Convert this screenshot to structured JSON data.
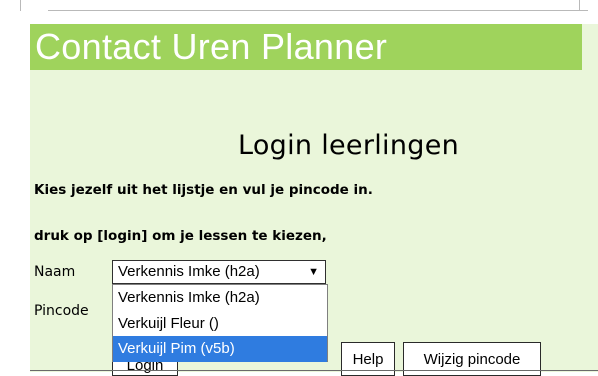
{
  "header": {
    "title": "Contact Uren Planner"
  },
  "login": {
    "title": "Login leerlingen",
    "instruction_1": "Kies jezelf uit het lijstje en vul je pincode in.",
    "instruction_2": "druk op [login] om je lessen te kiezen,",
    "naam_label": "Naam",
    "pincode_label": "Pincode",
    "select": {
      "selected": "Verkennis Imke (h2a)",
      "arrow": "▼",
      "options": [
        "Verkennis Imke (h2a)",
        "Verkuijl Fleur ()",
        "Verkuijl Pim (v5b)"
      ],
      "highlighted_index": 2
    },
    "buttons": {
      "login": "Login",
      "help": "Help",
      "change_pin": "Wijzig pincode"
    }
  },
  "colors": {
    "header_bg": "#9fd35c",
    "panel_bg": "#eaf6da",
    "highlight": "#2f7ce0"
  }
}
